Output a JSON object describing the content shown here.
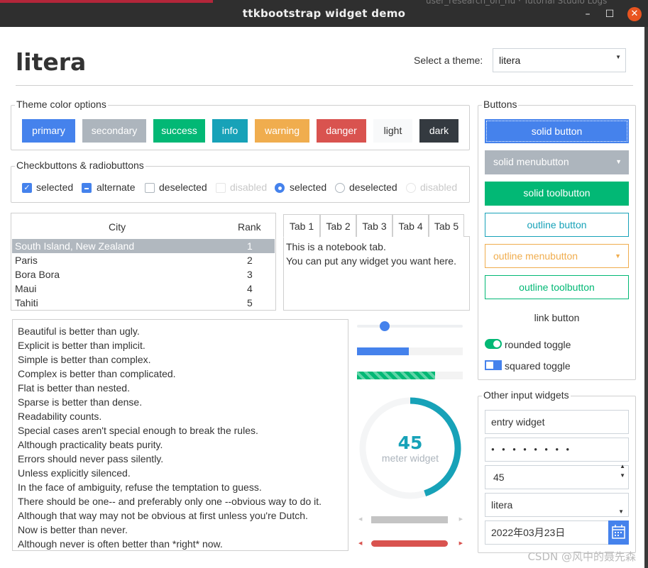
{
  "window": {
    "title": "ttkbootstrap widget demo",
    "bg_text": "user_research_on_hu · Tutorial Studio Logs"
  },
  "header": {
    "app_title": "litera",
    "theme_label": "Select a theme:",
    "theme_value": "litera"
  },
  "colors": {
    "primary": "#4582ec",
    "secondary": "#adb5bd",
    "success": "#02b875",
    "info": "#17a2b8",
    "warning": "#f0ad4e",
    "danger": "#d9534f",
    "light": "#f8f9fa",
    "dark": "#343a40"
  },
  "theme_colors": {
    "title": "Theme color options",
    "buttons": [
      "primary",
      "secondary",
      "success",
      "info",
      "warning",
      "danger",
      "light",
      "dark"
    ]
  },
  "checks": {
    "title": "Checkbuttons & radiobuttons",
    "items": [
      "selected",
      "alternate",
      "deselected",
      "disabled",
      "selected",
      "deselected",
      "disabled"
    ]
  },
  "tree": {
    "headers": [
      "City",
      "Rank"
    ],
    "rows": [
      {
        "city": "South Island, New Zealand",
        "rank": "1"
      },
      {
        "city": "Paris",
        "rank": "2"
      },
      {
        "city": "Bora Bora",
        "rank": "3"
      },
      {
        "city": "Maui",
        "rank": "4"
      },
      {
        "city": "Tahiti",
        "rank": "5"
      }
    ]
  },
  "notebook": {
    "tabs": [
      "Tab 1",
      "Tab 2",
      "Tab 3",
      "Tab 4",
      "Tab 5"
    ],
    "lines": [
      "This is a notebook tab.",
      "You can put any widget you want here."
    ]
  },
  "zen": [
    "Beautiful is better than ugly.",
    "Explicit is better than implicit.",
    "Simple is better than complex.",
    "Complex is better than complicated.",
    "Flat is better than nested.",
    "Sparse is better than dense.",
    "Readability counts.",
    "Special cases aren't special enough to break the rules.",
    "Although practicality beats purity.",
    "Errors should never pass silently.",
    "Unless explicitly silenced.",
    "In the face of ambiguity, refuse the temptation to guess.",
    "There should be one-- and preferably only one --obvious way to do it.",
    "Although that way may not be obvious at first unless you're Dutch.",
    "Now is better than never.",
    "Although never is often better than *right* now."
  ],
  "progress": {
    "bar1": 0.49,
    "bar2": 0.74
  },
  "meter": {
    "value": "45",
    "label": "meter widget"
  },
  "buttons_panel": {
    "title": "Buttons",
    "solid_button": "solid button",
    "solid_menubutton": "solid menubutton",
    "solid_toolbutton": "solid toolbutton",
    "outline_button": "outline button",
    "outline_menubutton": "outline menubutton",
    "outline_toolbutton": "outline toolbutton",
    "link_button": "link button",
    "rounded_toggle": "rounded toggle",
    "squared_toggle": "squared toggle"
  },
  "inputs": {
    "title": "Other input widgets",
    "entry": "entry widget",
    "password": "● ● ● ● ● ● ● ●",
    "spinbox": "45",
    "combobox": "litera",
    "date": "2022年03月23日"
  },
  "watermark": "CSDN @风中的聂先森"
}
